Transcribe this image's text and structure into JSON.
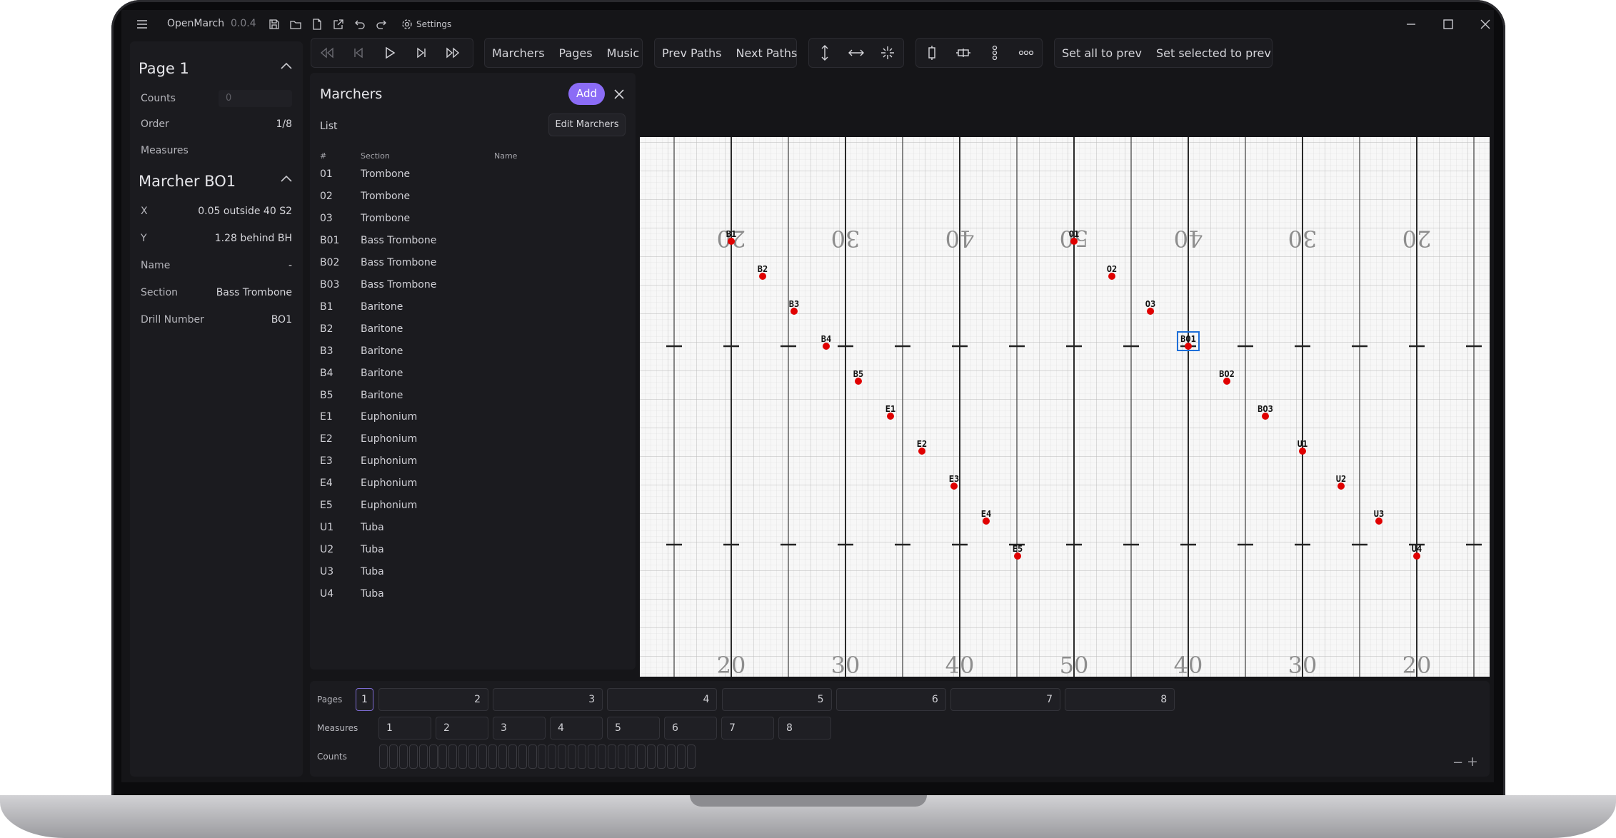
{
  "app": {
    "name": "OpenMarch",
    "version": "0.0.4",
    "settings_label": "Settings"
  },
  "page_panel": {
    "title": "Page 1",
    "counts_label": "Counts",
    "counts_placeholder": "0",
    "order_label": "Order",
    "order_value": "1/8",
    "measures_label": "Measures"
  },
  "marcher_panel": {
    "title": "Marcher BO1",
    "rows": [
      {
        "label": "X",
        "value": "0.05 outside 40 S2"
      },
      {
        "label": "Y",
        "value": "1.28 behind BH"
      },
      {
        "label": "Name",
        "value": "-"
      },
      {
        "label": "Section",
        "value": "Bass Trombone"
      },
      {
        "label": "Drill Number",
        "value": "BO1"
      }
    ]
  },
  "toolbar": {
    "view_buttons": [
      "Marchers",
      "Pages",
      "Music"
    ],
    "path_buttons": [
      "Prev Paths",
      "Next Paths"
    ],
    "prev_buttons": [
      "Set all to prev",
      "Set selected to prev"
    ]
  },
  "marchers_list": {
    "title": "Marchers",
    "add_label": "Add",
    "list_label": "List",
    "edit_label": "Edit Marchers",
    "columns": [
      "#",
      "Section",
      "Name"
    ],
    "rows": [
      {
        "num": "01",
        "section": "Trombone"
      },
      {
        "num": "02",
        "section": "Trombone"
      },
      {
        "num": "03",
        "section": "Trombone"
      },
      {
        "num": "B01",
        "section": "Bass Trombone"
      },
      {
        "num": "B02",
        "section": "Bass Trombone"
      },
      {
        "num": "B03",
        "section": "Bass Trombone"
      },
      {
        "num": "B1",
        "section": "Baritone"
      },
      {
        "num": "B2",
        "section": "Baritone"
      },
      {
        "num": "B3",
        "section": "Baritone"
      },
      {
        "num": "B4",
        "section": "Baritone"
      },
      {
        "num": "B5",
        "section": "Baritone"
      },
      {
        "num": "E1",
        "section": "Euphonium"
      },
      {
        "num": "E2",
        "section": "Euphonium"
      },
      {
        "num": "E3",
        "section": "Euphonium"
      },
      {
        "num": "E4",
        "section": "Euphonium"
      },
      {
        "num": "E5",
        "section": "Euphonium"
      },
      {
        "num": "U1",
        "section": "Tuba"
      },
      {
        "num": "U2",
        "section": "Tuba"
      },
      {
        "num": "U3",
        "section": "Tuba"
      },
      {
        "num": "U4",
        "section": "Tuba"
      }
    ]
  },
  "field": {
    "yard_numbers": [
      "20",
      "30",
      "40",
      "50",
      "40",
      "30",
      "20"
    ],
    "marchers": [
      "B1",
      "B2",
      "B3",
      "B4",
      "B5",
      "E1",
      "E2",
      "E3",
      "E4",
      "E5",
      "O1",
      "O2",
      "O3",
      "BO1",
      "BO2",
      "BO3",
      "U1",
      "U2",
      "U3",
      "U4"
    ],
    "selected": "BO1",
    "dot_color": "#e00000",
    "select_color": "#1e6fd9"
  },
  "timeline": {
    "pages_label": "Pages",
    "measures_label": "Measures",
    "counts_label": "Counts",
    "pages": [
      "1",
      "2",
      "3",
      "4",
      "5",
      "6",
      "7",
      "8"
    ],
    "measures": [
      "1",
      "2",
      "3",
      "4",
      "5",
      "6",
      "7",
      "8"
    ],
    "zoom_out": "−",
    "zoom_in": "+"
  },
  "colors": {
    "accent": "#8b6cf6",
    "background": "#151518",
    "panel": "#1b1b1f"
  }
}
